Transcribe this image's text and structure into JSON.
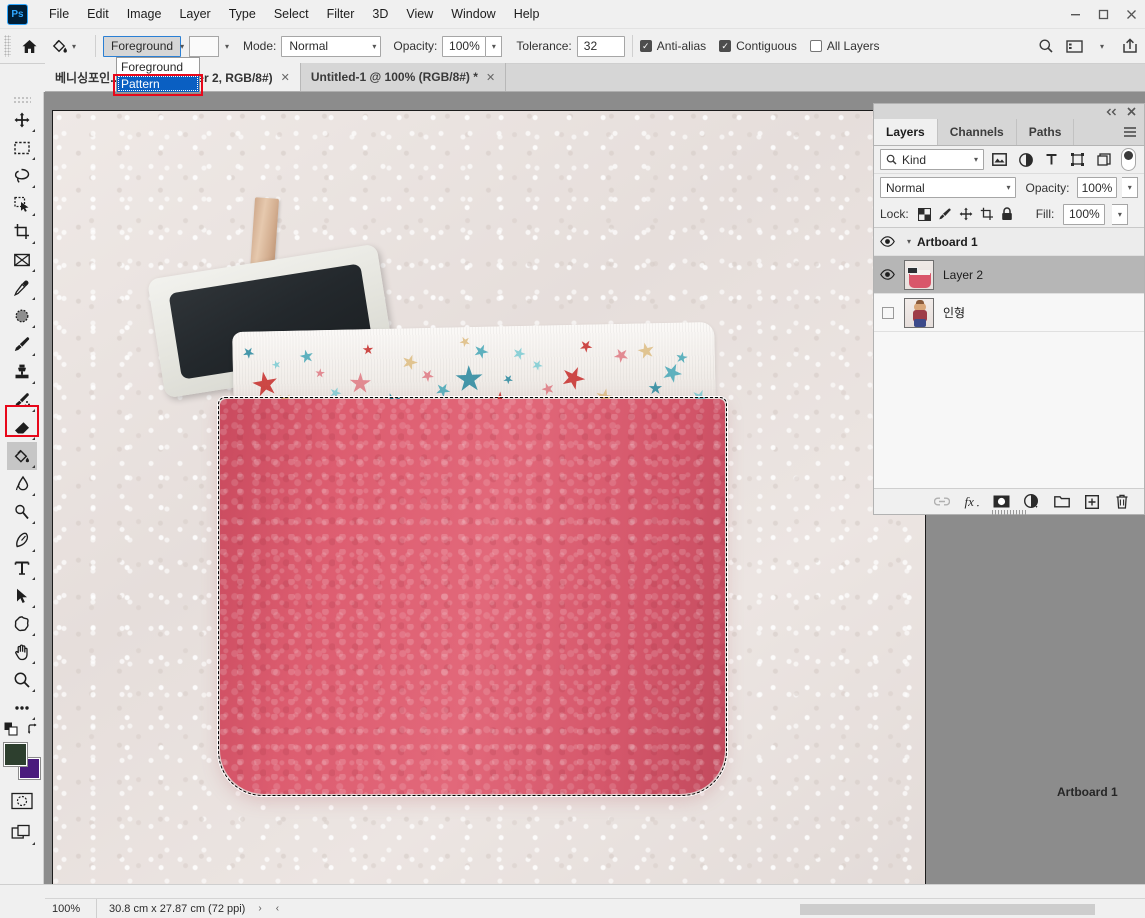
{
  "app": {
    "name": "Ps",
    "menu": [
      "File",
      "Edit",
      "Image",
      "Layer",
      "Type",
      "Select",
      "Filter",
      "3D",
      "View",
      "Window",
      "Help"
    ],
    "window_controls": {
      "minimize": "—",
      "maximize": "❐",
      "close": "✕"
    }
  },
  "options_bar": {
    "home_icon": "home-icon",
    "tool_icon": "paint-bucket-icon",
    "fill_source": {
      "value": "Foreground",
      "open": true
    },
    "pattern_swatch": "pattern-swatch",
    "mode": {
      "label": "Mode:",
      "value": "Normal"
    },
    "opacity": {
      "label": "Opacity:",
      "value": "100%"
    },
    "tolerance": {
      "label": "Tolerance:",
      "value": "32"
    },
    "checkboxes": [
      {
        "label": "Anti-alias",
        "checked": true
      },
      {
        "label": "Contiguous",
        "checked": true
      },
      {
        "label": "All Layers",
        "checked": false
      }
    ],
    "right_icons": [
      "search-icon",
      "workspace-icon",
      "share-icon"
    ]
  },
  "dropdown": {
    "items": [
      {
        "label": "Foreground",
        "selected": false
      },
      {
        "label": "Pattern",
        "selected": true
      }
    ],
    "highlight_color": "#e8071a"
  },
  "tabs": [
    {
      "label": "베니싱포인... @ 100% (Layer 2, RGB/8#)",
      "active": true,
      "close": "✕"
    },
    {
      "label": "Untitled-1 @ 100% (RGB/8#) *",
      "active": false,
      "close": "✕"
    }
  ],
  "toolbar": {
    "tools": [
      {
        "name": "move-tool",
        "icon": "move-icon",
        "selected": false
      },
      {
        "name": "rectangular-marquee-tool",
        "icon": "marquee-icon",
        "selected": false
      },
      {
        "name": "lasso-tool",
        "icon": "lasso-icon",
        "selected": false
      },
      {
        "name": "quick-selection-tool",
        "icon": "quick-select-icon",
        "selected": false
      },
      {
        "name": "crop-tool",
        "icon": "crop-icon",
        "selected": false
      },
      {
        "name": "frame-tool",
        "icon": "frame-icon",
        "selected": false
      },
      {
        "name": "eyedropper-tool",
        "icon": "eyedropper-icon",
        "selected": false
      },
      {
        "name": "spot-healing-brush-tool",
        "icon": "spot-healing-icon",
        "selected": false
      },
      {
        "name": "brush-tool",
        "icon": "brush-icon",
        "selected": false
      },
      {
        "name": "clone-stamp-tool",
        "icon": "clone-stamp-icon",
        "selected": false
      },
      {
        "name": "history-brush-tool",
        "icon": "history-brush-icon",
        "selected": false
      },
      {
        "name": "eraser-tool",
        "icon": "eraser-icon",
        "selected": false
      },
      {
        "name": "paint-bucket-tool",
        "icon": "paint-bucket-icon",
        "selected": true
      },
      {
        "name": "blur-tool",
        "icon": "smudge-icon",
        "selected": false
      },
      {
        "name": "dodge-tool",
        "icon": "dodge-icon",
        "selected": false
      },
      {
        "name": "pen-tool",
        "icon": "pen-icon",
        "selected": false
      },
      {
        "name": "type-tool",
        "icon": "type-icon",
        "selected": false
      },
      {
        "name": "path-selection-tool",
        "icon": "path-select-icon",
        "selected": false
      },
      {
        "name": "custom-shape-tool",
        "icon": "shape-icon",
        "selected": false
      },
      {
        "name": "hand-tool",
        "icon": "hand-icon",
        "selected": false
      },
      {
        "name": "zoom-tool",
        "icon": "zoom-icon",
        "selected": false
      },
      {
        "name": "edit-toolbar",
        "icon": "ellipsis-icon",
        "selected": false
      }
    ],
    "colors": {
      "foreground": "#2d3f2e",
      "background": "#4a1b7d",
      "default_icon": "default-colors-icon",
      "swap_icon": "swap-colors-icon"
    },
    "quick_mask_icon": "quick-mask-icon",
    "screen_mode_icon": "screen-mode-icon",
    "highlight_color": "#e8071a"
  },
  "canvas": {
    "background_color": "#8c8c8c",
    "artboard_label": "Artboard 1",
    "document": {
      "photo_description": "pink felt pouch with star fabric trim and wooden clothespin chalkboard tag",
      "pouch_color": "#d9566a",
      "trim_color": "#f7f4f1",
      "selection_active": true
    },
    "star_colors": [
      "#c8322f",
      "#4aa9b8",
      "#e07d86",
      "#dfbe84",
      "#2d8aa0",
      "#7fcdd4"
    ]
  },
  "panel": {
    "collapse_icon": "collapse-icon",
    "close_icon": "close-icon",
    "menu_icon": "panel-menu-icon",
    "tabs": [
      {
        "label": "Layers",
        "active": true
      },
      {
        "label": "Channels",
        "active": false
      },
      {
        "label": "Paths",
        "active": false
      }
    ],
    "filter": {
      "search_icon": "search-icon",
      "kind_label": "Kind",
      "filter_icons": [
        "pixel-filter-icon",
        "adjustment-filter-icon",
        "type-filter-icon",
        "shape-filter-icon",
        "smart-object-filter-icon"
      ],
      "toggle_icon": "filter-toggle-icon"
    },
    "blend": {
      "mode": "Normal",
      "opacity_label": "Opacity:",
      "opacity_value": "100%"
    },
    "lock": {
      "label": "Lock:",
      "icons": [
        "lock-transparent-pixels-icon",
        "lock-image-pixels-icon",
        "lock-position-icon",
        "lock-artboard-nesting-icon",
        "lock-all-icon"
      ],
      "fill_label": "Fill:",
      "fill_value": "100%"
    },
    "layers": [
      {
        "name": "Artboard 1",
        "type": "group",
        "visible": true,
        "selected": false,
        "expanded": true
      },
      {
        "name": "Layer 2",
        "type": "layer",
        "visible": true,
        "selected": true,
        "thumb": "pink-pouch-thumb"
      },
      {
        "name": "인형",
        "type": "layer",
        "visible": false,
        "selected": false,
        "thumb": "doll-thumb"
      }
    ],
    "bottom_icons": [
      "link-layers-icon",
      "layer-style-icon",
      "layer-mask-icon",
      "adjustment-layer-icon",
      "new-group-icon",
      "new-layer-icon",
      "delete-layer-icon"
    ]
  },
  "status_bar": {
    "zoom": "100%",
    "doc_size": "30.8 cm x 27.87 cm (72 ppi)",
    "expand_arrow": "›",
    "collapse_arrow": "‹"
  }
}
